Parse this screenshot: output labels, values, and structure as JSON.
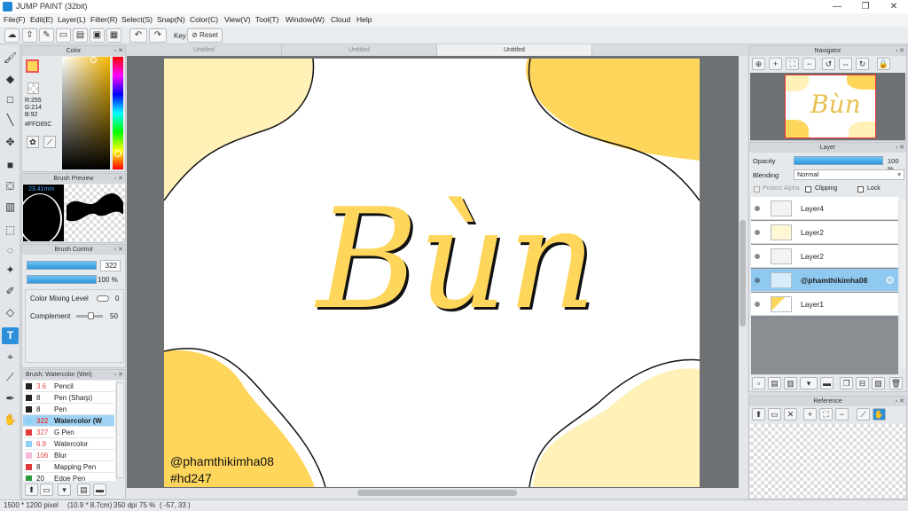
{
  "window": {
    "title": "JUMP PAINT (32bit)",
    "controls": [
      "—",
      "❐",
      "✕"
    ]
  },
  "menu": [
    "File(F)",
    "Edit(E)",
    "Layer(L)",
    "Filter(R)",
    "Select(S)",
    "Snap(N)",
    "Color(C)",
    "View(V)",
    "Tool(T)",
    "Window(W)",
    "Cloud",
    "Help"
  ],
  "toolbar": {
    "key_label": "Key",
    "reset_label": "Reset"
  },
  "tabs": [
    "Untitled",
    "Untitled",
    "Untitled"
  ],
  "color_panel": {
    "title": "Color",
    "r": "R:255",
    "g": "G:214",
    "b": "B:92",
    "hex": "#FFD65C",
    "main_color": "#FFD65C"
  },
  "brush_preview": {
    "title": "Brush Preview",
    "size": "23.41mm"
  },
  "brush_control": {
    "title": "Brush Control",
    "size_value": "322",
    "opacity_value": "100 %",
    "color_mixing_label": "Color Mixing Level",
    "color_mixing_value": "0",
    "complement_label": "Complement",
    "complement_value": "50"
  },
  "brush_list": {
    "title": "Brush: Watercolor (Wet)",
    "items": [
      {
        "size": "3.6",
        "name": "Pencil",
        "color": "#222222",
        "size_color": "#e24a4a"
      },
      {
        "size": "8",
        "name": "Pen (Sharp)",
        "color": "#222222",
        "size_color": "#222222"
      },
      {
        "size": "8",
        "name": "Pen",
        "color": "#222222",
        "size_color": "#222222"
      },
      {
        "size": "322",
        "name": "Watercolor (W",
        "color": "#8fd0f7",
        "size_color": "#e24a4a"
      },
      {
        "size": "327",
        "name": "G Pen",
        "color": "#e23a3a",
        "size_color": "#e24a4a"
      },
      {
        "size": "6.9",
        "name": "Watercolor",
        "color": "#8fd0f7",
        "size_color": "#e24a4a"
      },
      {
        "size": "106",
        "name": "Blur",
        "color": "#f3b8dc",
        "size_color": "#e24a4a"
      },
      {
        "size": "8",
        "name": "Mapping Pen",
        "color": "#e23a3a",
        "size_color": "#222222"
      },
      {
        "size": "20",
        "name": "Edge Pen",
        "color": "#2a9a3a",
        "size_color": "#222222"
      }
    ]
  },
  "canvas": {
    "lettering": "Bùn",
    "handle": "@phamthikimha08",
    "hashtag": "#hd247",
    "yellow_dark": "#FFD65C",
    "yellow_light": "#FFF1B8"
  },
  "navigator": {
    "title": "Navigator",
    "thumb_text": "Bùn"
  },
  "layer_panel": {
    "title": "Layer",
    "opacity_label": "Opacity",
    "opacity_value": "100 %",
    "blending_label": "Blending",
    "blending_value": "Normal",
    "protect_alpha": "Protect Alpha",
    "clipping": "Clipping",
    "lock": "Lock",
    "layers": [
      {
        "name": "Layer4",
        "selected": false
      },
      {
        "name": "Layer2",
        "selected": false
      },
      {
        "name": "Layer2",
        "selected": false
      },
      {
        "name": "@phamthikimha08",
        "selected": true
      },
      {
        "name": "Layer1",
        "selected": false
      }
    ]
  },
  "reference": {
    "title": "Reference"
  },
  "status": {
    "size": "1500 * 1200 pixel",
    "dims": "(10.9 * 8.7cm)",
    "dpi": "350 dpi",
    "zoom": "75 %",
    "coords": "( -57, 33 )"
  }
}
